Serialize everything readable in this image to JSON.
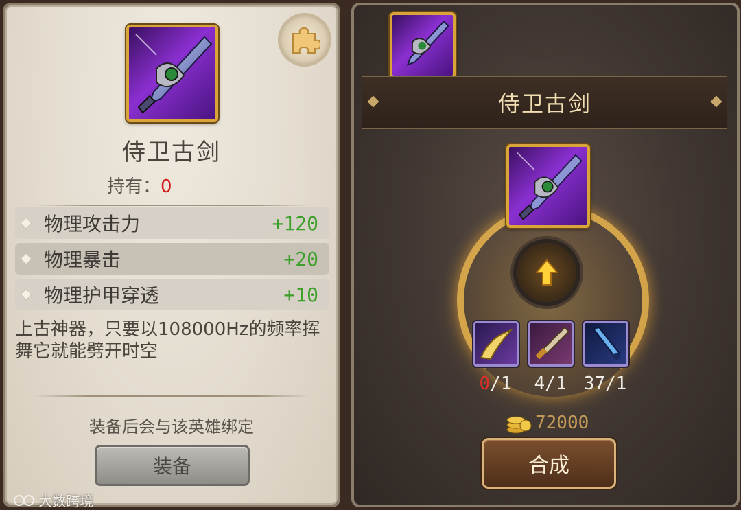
{
  "left_panel": {
    "item_name": "侍卫古剑",
    "owned_label": "持有：",
    "owned_count": "0",
    "stats": [
      {
        "name": "物理攻击力",
        "value": "+120"
      },
      {
        "name": "物理暴击",
        "value": "+20"
      },
      {
        "name": "物理护甲穿透",
        "value": "+10"
      }
    ],
    "description": "上古神器，只要以108000Hz的频率挥舞它就能劈开时空",
    "bind_notice": "装备后会与该英雄绑定",
    "equip_label": "装备",
    "watermark": "大数跨境"
  },
  "right_panel": {
    "item_name": "侍卫古剑",
    "materials": [
      {
        "have": "0",
        "need": "/1",
        "icon": "yellow-blade-icon"
      },
      {
        "have": "4/1",
        "need": "",
        "icon": "golden-sword-icon"
      },
      {
        "have": "37/1",
        "need": "",
        "icon": "blue-sword-icon"
      }
    ],
    "gold_cost": "72000",
    "compose_label": "合成"
  },
  "colors": {
    "stat_value": "#3aa028",
    "owned_zero": "#d21a1a",
    "title_gold": "#f0ddb2",
    "gold_text": "#c49a58"
  }
}
